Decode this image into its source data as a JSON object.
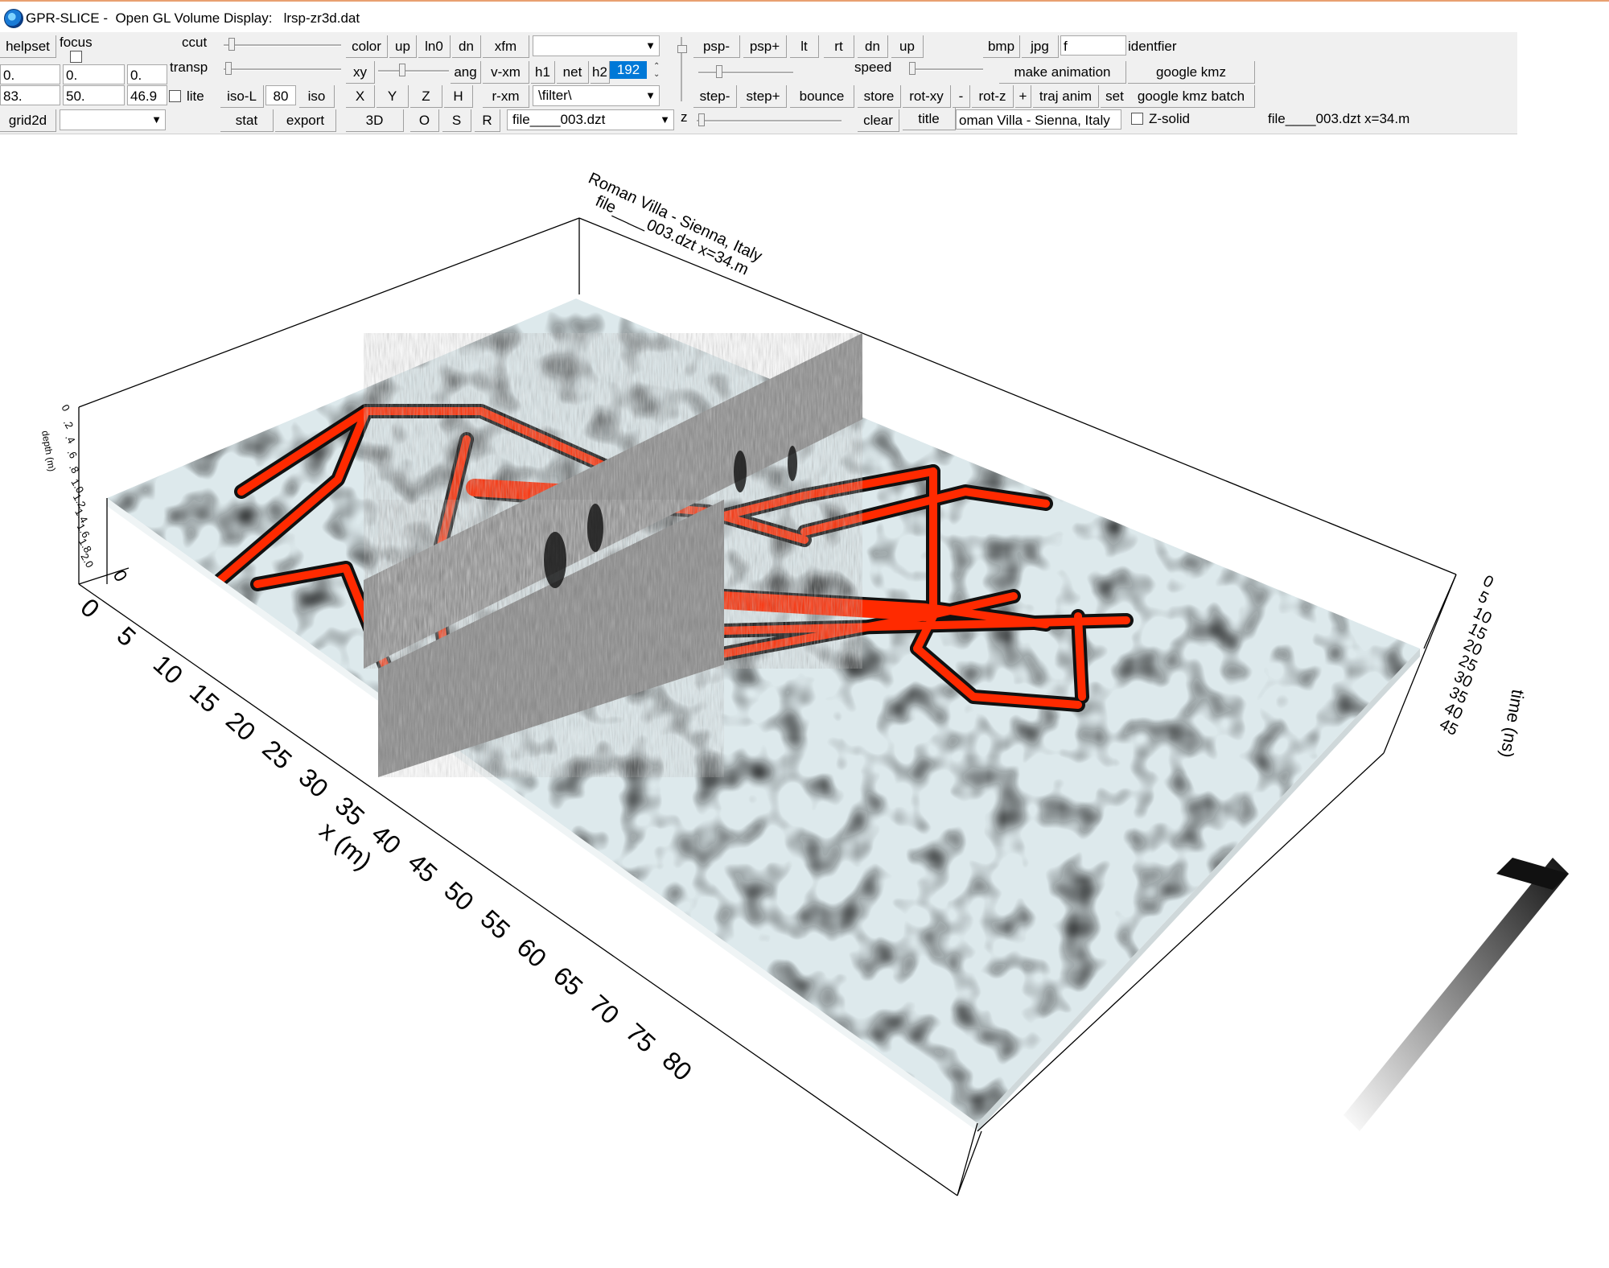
{
  "window": {
    "title": "GPR-SLICE -  Open GL Volume Display:   lrsp-zr3d.dat"
  },
  "toolbar": {
    "helpset": "helpset",
    "focus": "focus",
    "ccut": "ccut",
    "transp": "transp",
    "field_a": "0.",
    "field_b": "0.",
    "field_c": "0.",
    "field_d": "83.",
    "field_e": "50.",
    "field_f": "46.9",
    "lite": "lite",
    "iso_l": "iso-L",
    "iso_l_value": "80",
    "iso": "iso",
    "grid2d": "grid2d",
    "stat": "stat",
    "export": "export",
    "color": "color",
    "up": "up",
    "ln0": "ln0",
    "dn": "dn",
    "xfm": "xfm",
    "xy": "xy",
    "ang": "ang",
    "v_xm": "v-xm",
    "h1": "h1",
    "net": "net",
    "h2": "h2",
    "h2_value": "192",
    "X": "X",
    "Y": "Y",
    "Z": "Z",
    "H": "H",
    "r_xm": "r-xm",
    "filter_combo": "\\filter\\",
    "btn_3d": "3D",
    "O": "O",
    "S": "S",
    "R": "R",
    "file_combo": "file____003.dzt",
    "psp_minus": "psp-",
    "psp_plus": "psp+",
    "lt": "lt",
    "rt": "rt",
    "dn2": "dn",
    "up2": "up",
    "speed": "speed",
    "step_minus": "step-",
    "step_plus": "step+",
    "bounce": "bounce",
    "store": "store",
    "rot_xy": "rot-xy",
    "minus": "-",
    "rot_z": "rot-z",
    "plus": "+",
    "traj_anim": "traj anim",
    "set": "set",
    "z": "z",
    "clear": "clear",
    "title_btn": "title",
    "title_value": "oman Villa - Sienna, Italy",
    "bmp": "bmp",
    "jpg": "jpg",
    "identifier_value": "f",
    "identifier": "identfier",
    "make_animation": "make animation",
    "google_kmz": "google kmz",
    "google_kmz_batch": "google kmz batch",
    "z_solid": "Z-solid",
    "status": "file____003.dzt   x=34.m"
  },
  "plot": {
    "title_line1": "Roman Villa - Sienna, Italy",
    "title_line2": "file____003.dzt    x=34.m",
    "x_label": "x (m)",
    "x_ticks": [
      "0",
      "5",
      "10",
      "15",
      "20",
      "25",
      "30",
      "35",
      "40",
      "45",
      "50",
      "55",
      "60",
      "65",
      "70",
      "75",
      "80"
    ],
    "time_label": "time (ns)",
    "time_ticks": [
      "0",
      "5",
      "10",
      "15",
      "20",
      "25",
      "30",
      "35",
      "40",
      "45"
    ],
    "depth_label": "depth (m)",
    "depth_ticks": [
      "0",
      ".2",
      ".4",
      ".6",
      ".8",
      "1.0",
      "1.2",
      "1.4",
      "1.6",
      "1.8",
      "2.0"
    ],
    "depth_bottom": "0",
    "colors": {
      "anomaly": "#ff2a00",
      "outline": "#111111",
      "background": "#dde9ec"
    }
  }
}
